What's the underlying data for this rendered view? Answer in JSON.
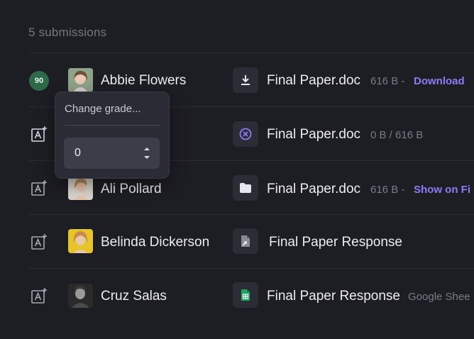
{
  "header": {
    "title": "5 submissions"
  },
  "popover": {
    "title": "Change grade...",
    "value": "0"
  },
  "rows": [
    {
      "grade": "90",
      "name": "Abbie Flowers",
      "file_icon": "download-icon",
      "file_name": "Final Paper.doc",
      "meta": "616 B -",
      "link": "Download"
    },
    {
      "grade": "",
      "name": "",
      "file_icon": "x-circle-icon",
      "file_name": "Final Paper.doc",
      "meta": "0 B / 616 B",
      "link": ""
    },
    {
      "grade": "",
      "name": "Ali Pollard",
      "file_icon": "folder-icon",
      "file_name": "Final Paper.doc",
      "meta": "616 B -",
      "link": "Show on Fi"
    },
    {
      "grade": "",
      "name": "Belinda Dickerson",
      "file_icon": "document-shortcut-icon",
      "file_name": "Final Paper Response",
      "meta": "",
      "link": ""
    },
    {
      "grade": "",
      "name": "Cruz Salas",
      "file_icon": "google-sheets-icon",
      "file_name": "Final Paper Response",
      "meta": "Google Shee",
      "link": ""
    }
  ],
  "colors": {
    "accent": "#8b7cf6",
    "badge": "#2e6a49",
    "background": "#1d1d24",
    "sheets": "#1fa463"
  }
}
